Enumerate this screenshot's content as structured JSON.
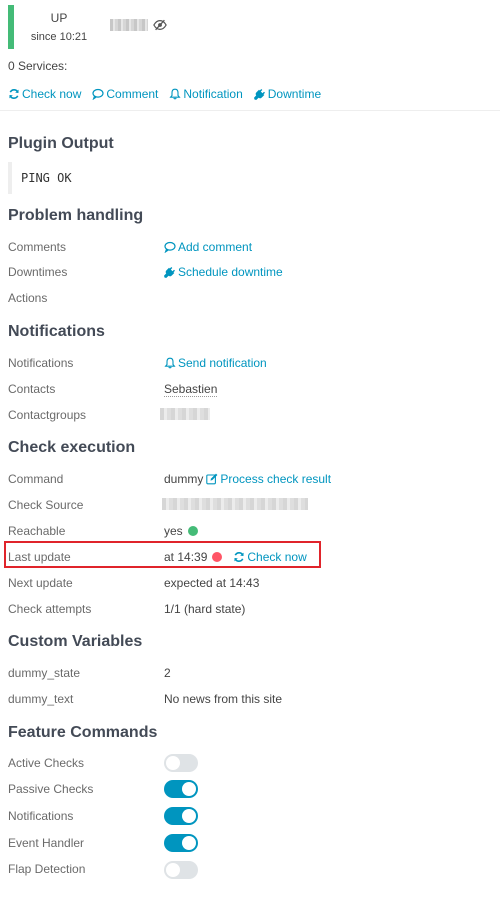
{
  "header": {
    "state": "UP",
    "since": "since 10:21",
    "state_color": "#44bb77",
    "services_summary": "0 Services:"
  },
  "actions": [
    {
      "label": "Check now",
      "icon": "refresh-icon"
    },
    {
      "label": "Comment",
      "icon": "comment-icon"
    },
    {
      "label": "Notification",
      "icon": "bell-icon"
    },
    {
      "label": "Downtime",
      "icon": "plug-icon"
    }
  ],
  "plugin_output": {
    "title": "Plugin Output",
    "text": "PING OK"
  },
  "problem_handling": {
    "title": "Problem handling",
    "comments_label": "Comments",
    "add_comment": "Add comment",
    "downtimes_label": "Downtimes",
    "schedule_downtime": "Schedule downtime",
    "actions_label": "Actions"
  },
  "notifications": {
    "title": "Notifications",
    "notifications_label": "Notifications",
    "send_notification": "Send notification",
    "contacts_label": "Contacts",
    "contact": "Sebastien",
    "contactgroups_label": "Contactgroups"
  },
  "check_execution": {
    "title": "Check execution",
    "command_label": "Command",
    "command": "dummy",
    "process_check_result": "Process check result",
    "check_source_label": "Check Source",
    "reachable_label": "Reachable",
    "reachable": "yes",
    "reachable_color": "#44bb77",
    "last_update_label": "Last update",
    "last_update": "at 14:39",
    "last_update_color": "#ff5566",
    "check_now": "Check now",
    "next_update_label": "Next update",
    "next_update": "expected at 14:43",
    "check_attempts_label": "Check attempts",
    "check_attempts": "1/1 (hard state)"
  },
  "custom_variables": {
    "title": "Custom Variables",
    "vars": [
      {
        "name": "dummy_state",
        "value": "2"
      },
      {
        "name": "dummy_text",
        "value": "No news from this site"
      }
    ]
  },
  "feature_commands": {
    "title": "Feature Commands",
    "items": [
      {
        "label": "Active Checks",
        "enabled": false
      },
      {
        "label": "Passive Checks",
        "enabled": true
      },
      {
        "label": "Notifications",
        "enabled": true
      },
      {
        "label": "Event Handler",
        "enabled": true
      },
      {
        "label": "Flap Detection",
        "enabled": false
      }
    ]
  },
  "colors": {
    "accent": "#0095bf",
    "highlight_box": "#e0242b"
  }
}
